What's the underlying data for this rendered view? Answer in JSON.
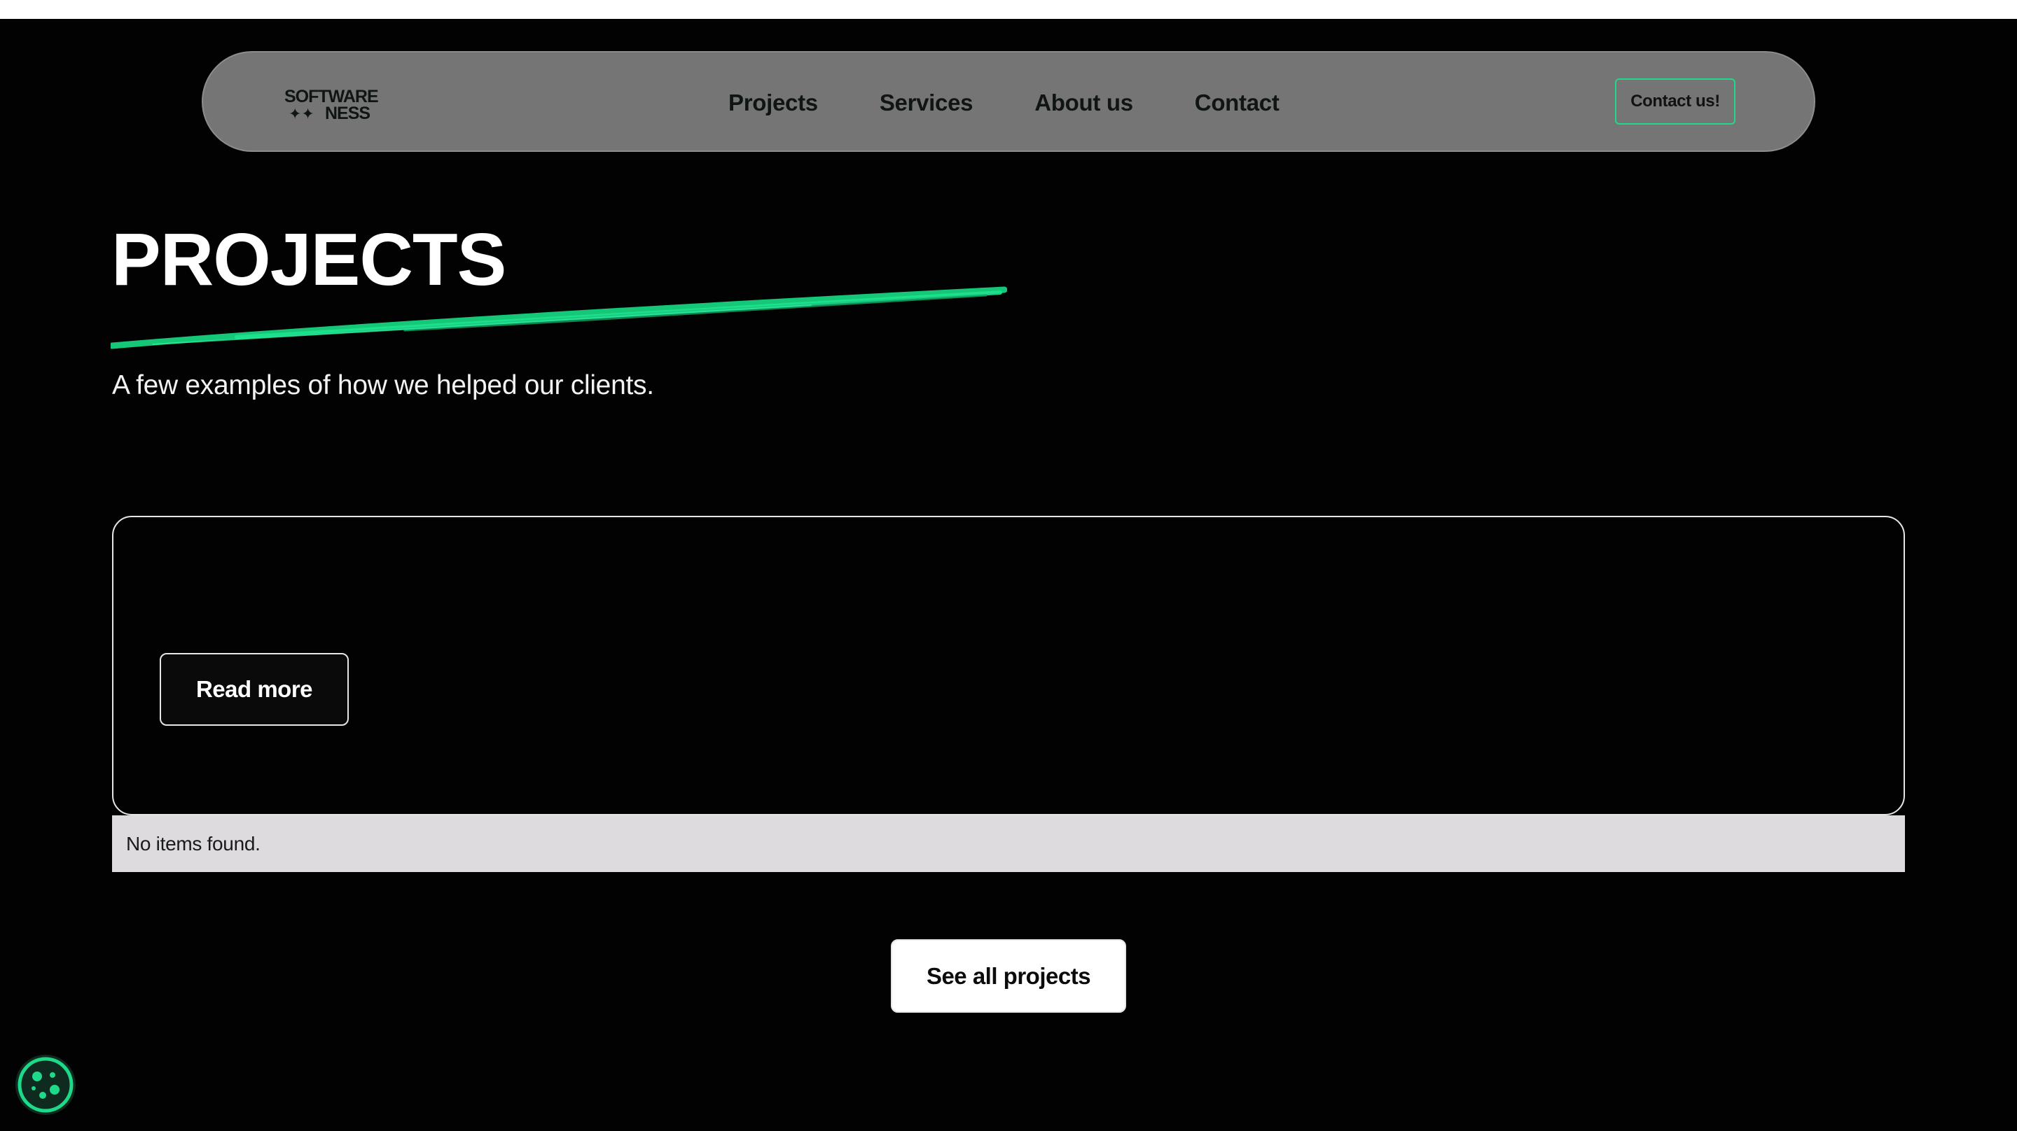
{
  "colors": {
    "background": "#030203",
    "navbar": "#767576",
    "accent_green": "#1ed98a",
    "empty_state_bg": "#dddbde"
  },
  "header": {
    "logo_line1": "SOFTWARE",
    "logo_line2": "NESS",
    "nav": [
      {
        "label": "Projects"
      },
      {
        "label": "Services"
      },
      {
        "label": "About us"
      },
      {
        "label": "Contact"
      }
    ],
    "cta_label": "Contact us!"
  },
  "hero": {
    "title": "PROJECTS",
    "subtitle": "A few examples of how we helped our clients."
  },
  "projects": {
    "card": {
      "read_more_label": "Read more"
    },
    "empty_message": "No items found.",
    "see_all_label": "See all projects"
  },
  "cookie": {
    "icon": "cookie-icon"
  }
}
